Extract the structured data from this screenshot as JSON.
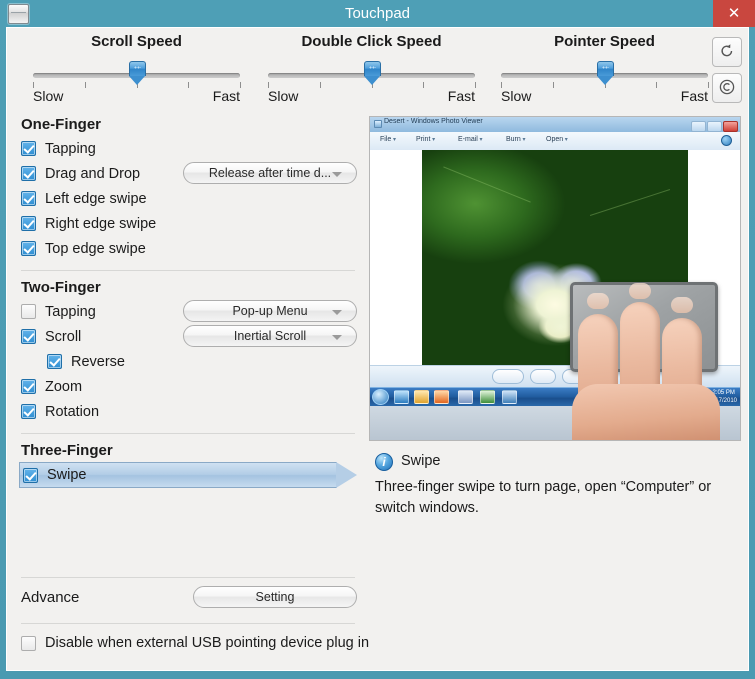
{
  "window": {
    "title": "Touchpad",
    "icon": "touchpad-icon",
    "close_label": "✕",
    "accent_color": "#4e9fb6",
    "close_color": "#c9473f"
  },
  "sliders": [
    {
      "name": "scroll-speed",
      "title": "Scroll Speed",
      "low_label": "Slow",
      "high_label": "Fast",
      "ticks": 5,
      "value": 3,
      "max": 5
    },
    {
      "name": "double-click-speed",
      "title": "Double Click Speed",
      "low_label": "Slow",
      "high_label": "Fast",
      "ticks": 5,
      "value": 3,
      "max": 5
    },
    {
      "name": "pointer-speed",
      "title": "Pointer Speed",
      "low_label": "Slow",
      "high_label": "Fast",
      "ticks": 5,
      "value": 3,
      "max": 5
    }
  ],
  "toolbuttons": {
    "restore": "restore-defaults-icon",
    "about": "about-copyright-icon"
  },
  "groups": {
    "one_finger": {
      "title": "One-Finger",
      "rows": [
        {
          "label": "Tapping",
          "checked": true,
          "dropdown": null
        },
        {
          "label": "Drag and Drop",
          "checked": true,
          "dropdown": "Release after time d..."
        },
        {
          "label": "Left edge swipe",
          "checked": true,
          "dropdown": null
        },
        {
          "label": "Right edge swipe",
          "checked": true,
          "dropdown": null
        },
        {
          "label": "Top edge swipe",
          "checked": true,
          "dropdown": null
        }
      ]
    },
    "two_finger": {
      "title": "Two-Finger",
      "rows": [
        {
          "label": "Tapping",
          "checked": false,
          "dropdown": "Pop-up Menu"
        },
        {
          "label": "Scroll",
          "checked": true,
          "dropdown": "Inertial Scroll"
        },
        {
          "label": "Reverse",
          "checked": true,
          "dropdown": null,
          "indent": true
        },
        {
          "label": "Zoom",
          "checked": true,
          "dropdown": null
        },
        {
          "label": "Rotation",
          "checked": true,
          "dropdown": null
        }
      ]
    },
    "three_finger": {
      "title": "Three-Finger",
      "rows": [
        {
          "label": "Swipe",
          "checked": true,
          "selected": true
        }
      ]
    }
  },
  "advance": {
    "label": "Advance",
    "setting_button": "Setting"
  },
  "usb_option": {
    "label": "Disable when external USB pointing device plug in",
    "checked": false
  },
  "preview": {
    "photo_viewer": {
      "title": "Desert - Windows Photo Viewer",
      "menu": [
        "File",
        "Print",
        "E-mail",
        "Burn",
        "Open"
      ],
      "clock_time": "2:05 PM",
      "clock_date": "6/17/2010"
    },
    "alt": "three fingers swiping on a touchpad over a Windows desktop"
  },
  "description": {
    "icon": "info-icon",
    "title": "Swipe",
    "body": "Three-finger swipe to turn page, open “Computer” or switch windows."
  }
}
